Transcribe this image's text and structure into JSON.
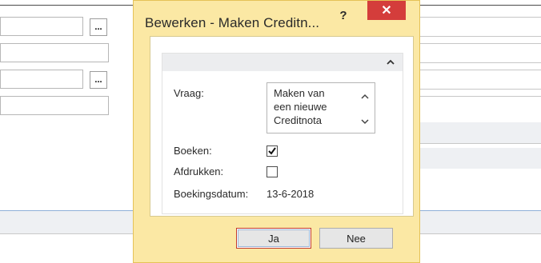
{
  "dialog": {
    "title": "Bewerken - Maken Creditn...",
    "help_label": "?",
    "close_label": "✕",
    "fields": {
      "vraag_label": "Vraag:",
      "vraag_value": "Maken van\neen nieuwe\nCreditnota",
      "boeken_label": "Boeken:",
      "boeken_checked": true,
      "afdrukken_label": "Afdrukken:",
      "afdrukken_checked": false,
      "boekingsdatum_label": "Boekingsdatum:",
      "boekingsdatum_value": "13-6-2018"
    },
    "buttons": {
      "yes_label": "Ja",
      "no_label": "Nee"
    }
  },
  "background": {
    "lookup_button_label": "..."
  },
  "icons": {
    "collapse": "chevron-up-icon",
    "scroll_up": "chevron-up-icon",
    "scroll_down": "chevron-down-icon",
    "check": "checkmark-icon",
    "close": "close-icon",
    "help": "help-icon"
  },
  "colors": {
    "dialog_frame": "#fbe8a4",
    "close_button": "#d43d3b",
    "default_button_border": "#c0392b"
  }
}
